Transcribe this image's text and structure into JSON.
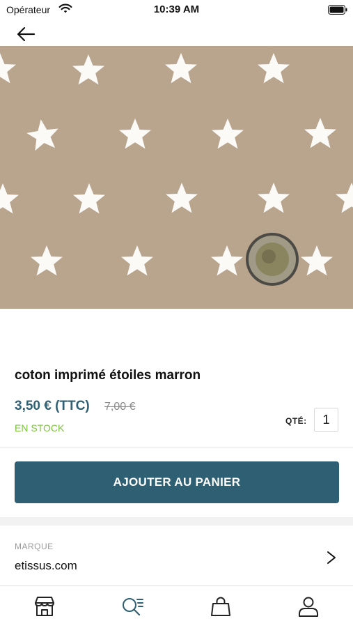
{
  "status_bar": {
    "carrier": "Opérateur",
    "time": "10:39 AM"
  },
  "product": {
    "title": "coton imprimé étoiles marron",
    "price": "3,50 € (TTC)",
    "old_price": "7,00 €",
    "stock_status": "EN STOCK",
    "qty_label": "QTÉ:",
    "qty_value": "1"
  },
  "actions": {
    "add_to_cart": "AJOUTER AU PANIER"
  },
  "brand": {
    "label": "MARQUE",
    "value": "etissus.com"
  },
  "tab_bar": {
    "items": [
      {
        "icon": "store-icon",
        "active": false
      },
      {
        "icon": "search-list-icon",
        "active": true
      },
      {
        "icon": "shopping-bag-icon",
        "active": false
      },
      {
        "icon": "user-icon",
        "active": false
      }
    ]
  },
  "colors": {
    "accent": "#2e5f72",
    "in_stock": "#7cc43e",
    "fabric": "#b9a48e"
  }
}
